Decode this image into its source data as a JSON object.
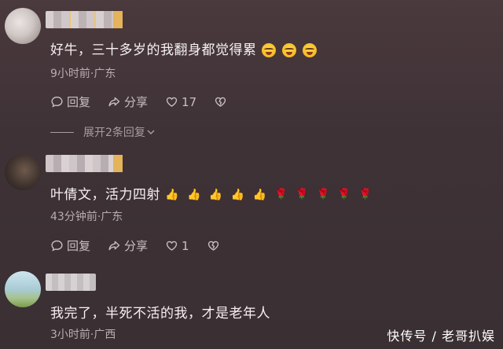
{
  "comments": [
    {
      "text": "好牛，三十多岁的我翻身都觉得累",
      "emoji_faces": 3,
      "meta": "9小时前·广东",
      "reply_label": "回复",
      "share_label": "分享",
      "like_count": "17",
      "expand_label": "展开2条回复"
    },
    {
      "text": "叶倩文，活力四射",
      "thumbs": [
        "👍",
        "👍",
        "👍",
        "👍",
        "👍"
      ],
      "roses": [
        "🌹",
        "🌹",
        "🌹",
        "🌹",
        "🌹"
      ],
      "meta": "43分钟前·广东",
      "reply_label": "回复",
      "share_label": "分享",
      "like_count": "1"
    },
    {
      "text": "我完了，半死不活的我，才是老年人",
      "meta": "3小时前·广西"
    }
  ],
  "watermark": "快传号 / 老哥扒娱",
  "icons": {
    "reply": "comment-bubble-icon",
    "share": "share-arrow-icon",
    "like": "heart-icon",
    "dislike": "broken-heart-icon",
    "expand": "chevron-down-icon"
  }
}
